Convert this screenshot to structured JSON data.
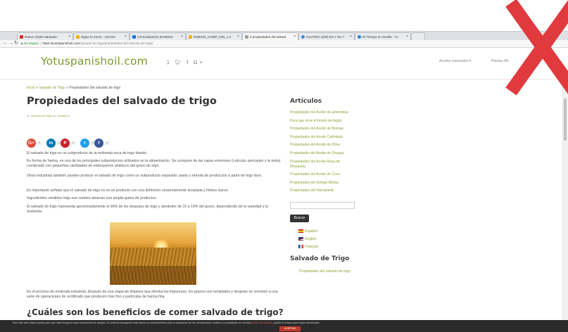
{
  "browser": {
    "tabs": [
      {
        "label": "Nuevo chalet adosado ·",
        "icon": "gmail-icon",
        "color": "#d93025"
      },
      {
        "label": "Sigue tu envío - correos",
        "icon": "correos-icon",
        "color": "#f0b400"
      },
      {
        "label": "CD Evaluación (RSBIUN",
        "icon": "drive-icon",
        "color": "#1a73e8"
      },
      {
        "label": "RSBIUN_COMP_DIG_1.2",
        "icon": "file-icon",
        "color": "#f4b400"
      },
      {
        "label": "6 propiedades del salvad",
        "icon": "page-icon",
        "color": "#9e9e9e"
      },
      {
        "label": "GLUTEN: QUÉ ES Y SU ?",
        "icon": "site-icon",
        "color": "#4285f4"
      },
      {
        "label": "El Tiempo en Sevilla - Tu",
        "icon": "weather-icon",
        "color": "#1e88e5"
      }
    ],
    "secure_label": "Es seguro",
    "url_prefix": "https://yotuspanishoil.com",
    "url_rest": "/salvado-de-trigo/propiedades-del-salvado-de-trigo/"
  },
  "header": {
    "logo": "Yotuspanishoil.com",
    "social": " λ 𝐟 G+",
    "nav": [
      "Aceites esenciales ▾",
      "Plantas Me"
    ]
  },
  "article": {
    "breadcrumb": {
      "home": "Inicio",
      "sep1": " » ",
      "cat": "Salvado de Trigo",
      "sep2": " » ",
      "current": "Propiedades del salvado de trigo"
    },
    "title": "Propiedades del salvado de trigo",
    "meta": {
      "in": "en",
      "category": "Salvado de Trigo",
      "by": "por",
      "author": "Daniela S"
    },
    "share": {
      "labels": [
        "G+",
        "in",
        "P",
        "t",
        "f"
      ],
      "count": "0"
    },
    "paragraphs": [
      "El salvado de trigo es un subproducto de la molienda seca de trigo blando.",
      "En forma de harina, es uno de los principales subproductos utilizados en la alimentación. Se compone de las capas exteriores (cutícula, pericarpio y la testa) combinado con pequeñas cantidades de endospermo amiláceo del grano de trigo.",
      "Otras industrias también pueden producir el salvado de trigo como un subproducto separado: pasta y sémola de producción a partir de trigo duro.",
      "Es importante señalar que el salvado de trigo no es un producto con una definición universalmente aceptada y límites claros.",
      "Ingredientes vendidos bajo ese nombre abarcan una amplia gama de productos.",
      "El salvado de trigo representa aproximadamente el 90% de los despojos de trigo y alrededor de 10 a 19% del grano, dependiendo de la variedad y la molienda.",
      "En el proceso de molienda industrial, después de una etapa de limpieza que elimina las impurezas, los granos son templados y después se someten a una serie de operaciones de rectificado que producen más fino y partículas de harina fina."
    ],
    "h2": "¿Cuáles son los beneficios de comer salvado de trigo?"
  },
  "sidebar": {
    "articles_title": "Artículos",
    "articles": [
      "Propiedades del Aceite de almendras",
      "Para que sirve el Aceite de Argán",
      "Propiedades del Aceite de Borraja",
      "Propiedades del Aceite Caléndula",
      "Propiedades del Aceite de Oliva",
      "Propiedades del Aceite de Onagra",
      "Propiedades del Aceite Rosa de Mosqueta",
      "Propiedades del Aceite de Coco",
      "Propiedades del Ginkgo Biloba",
      "Propiedades del Hamamelis"
    ],
    "search_button": "Buscar",
    "languages": [
      "Español",
      "English",
      "Français"
    ],
    "section_title": "Salvado de Trigo",
    "section_link": "Propiedades del salvado de trigo"
  },
  "cookie": {
    "text": "Este sitio web utiliza cookies para que usted tenga la mejor experiencia de usuario. Si continúa navegando está dando su consentimiento para la aceptación de las mencionadas cookies y la aceptación de nuestra",
    "link": "política de cookies",
    "text2": ", pinche el enlace para mayor información.",
    "button": "ACEPTAR"
  },
  "colors": {
    "brand_green": "#7b9a2c",
    "link_green": "#8aa53a",
    "overlay_x": "#e0393e"
  }
}
